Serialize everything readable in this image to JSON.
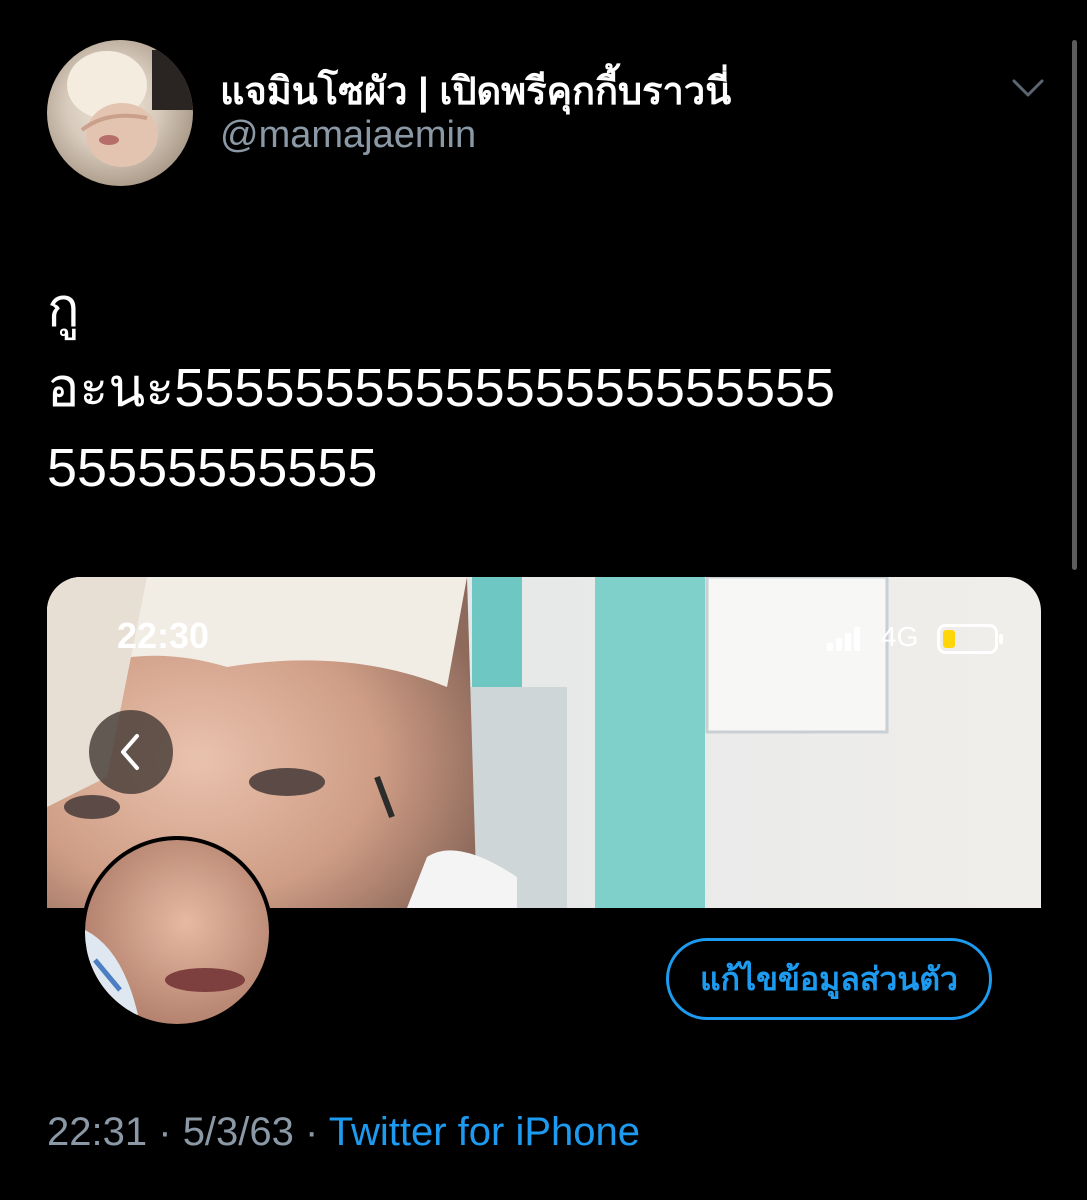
{
  "tweet": {
    "author": {
      "display_name": "แจมินโซผัว | เปิดพรีคุกกี้บราวนี่",
      "handle": "@mamajaemin"
    },
    "text": "กู\nอะนะ5555555555555555555555\n55555555555",
    "timestamp": "22:31",
    "separator": "·",
    "date": "5/3/63",
    "source": "Twitter for iPhone"
  },
  "screenshot": {
    "status_time": "22:30",
    "network": "4G",
    "edit_profile_label": "แก้ไขข้อมูลส่วนตัว"
  },
  "icons": {
    "menu": "chevron-down-icon",
    "back": "chevron-left-icon",
    "signal": "signal-bars-icon",
    "battery": "battery-icon"
  },
  "colors": {
    "background": "#000000",
    "accent": "#1d9bf0",
    "secondary_text": "#8b98a5",
    "battery_level": "#ffd60a"
  }
}
